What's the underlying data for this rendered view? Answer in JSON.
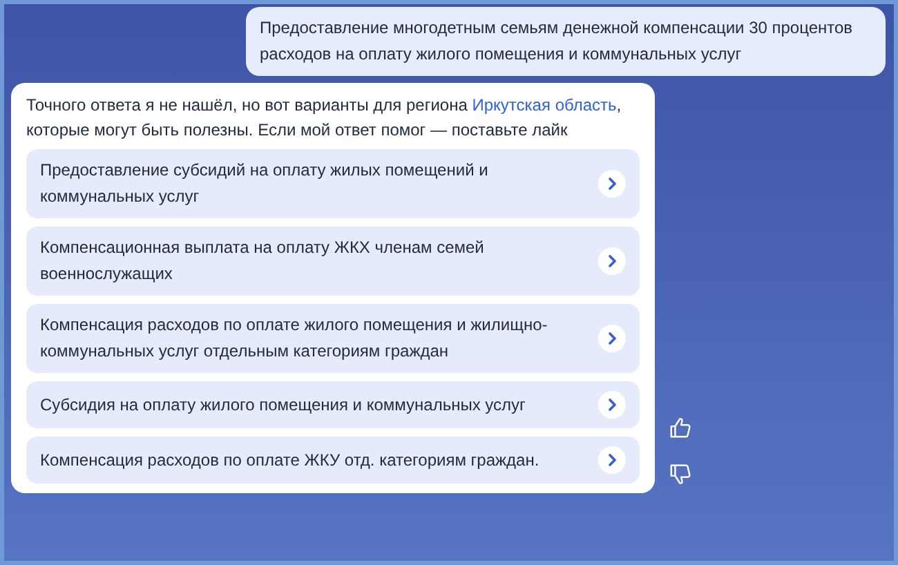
{
  "user_message": {
    "text": "Предоставление многодетным семьям денежной компенсации 30 процентов расходов на оплату жилого помещения и коммунальных услуг"
  },
  "bot_message": {
    "text_before": "Точного ответа я не нашёл, но вот варианты для региона",
    "link": "Иркутская область",
    "text_after": ", которые могут быть полезны. Если мой ответ помог — поставьте лайк",
    "options": [
      {
        "label": "Предоставление субсидий на оплату жилых помещений и коммунальных услуг"
      },
      {
        "label": "Компенсационная выплата на оплату ЖКХ членам семей военнослужащих"
      },
      {
        "label": "Компенсация расходов по оплате жилого помещения и жилищно-коммунальных услуг отдельным категориям граждан"
      },
      {
        "label": "Субсидия на оплату жилого помещения и коммунальных услуг"
      },
      {
        "label": "Компенсация расходов по оплате ЖКУ отд. категориям граждан."
      }
    ]
  }
}
